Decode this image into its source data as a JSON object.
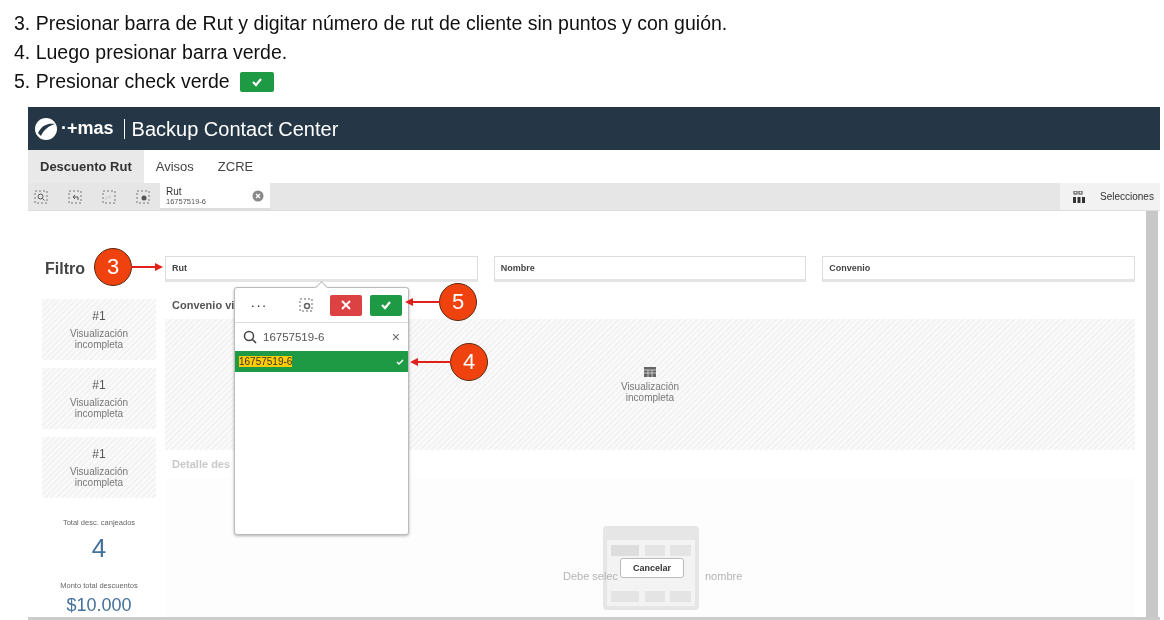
{
  "instructions": [
    {
      "text": "3. Presionar barra de Rut y digitar número de rut de cliente sin puntos y con guión."
    },
    {
      "text": "4. Luego presionar barra verde."
    },
    {
      "text": "5. Presionar check verde",
      "icon": true
    }
  ],
  "app": {
    "logo_text": "·+mas",
    "title": "Backup Contact Center",
    "tabs": [
      {
        "label": "Descuento Rut",
        "selected": true
      },
      {
        "label": "Avisos",
        "selected": false
      },
      {
        "label": "ZCRE",
        "selected": false
      }
    ],
    "selection_chip": {
      "field": "Rut",
      "value": "16757519-6"
    },
    "selections_label": "Selecciones",
    "filter_title": "Filtro",
    "filters": [
      {
        "label": "Rut"
      },
      {
        "label": "Nombre"
      },
      {
        "label": "Convenio"
      }
    ],
    "kpi_cards": [
      {
        "rank": "#1",
        "text": "Visualización incompleta"
      },
      {
        "rank": "#1",
        "text": "Visualización incompleta"
      },
      {
        "rank": "#1",
        "text": "Visualización incompleta"
      }
    ],
    "kpis": [
      {
        "label": "Total desc. canjeados",
        "value": "4"
      },
      {
        "label": "Monto total descuentos",
        "value": "$10.000"
      }
    ],
    "convenio_title": "Convenio vi",
    "convenio_placeholder": "Visualización incompleta",
    "detalle_title": "Detalle des",
    "empty_message_parts": [
      "Debe selec",
      "nombre"
    ],
    "cancel_button": "Cancelar",
    "listbox": {
      "menu": "···",
      "search": "16757519-6",
      "clear": "×",
      "items": [
        {
          "value": "16757519-6",
          "selected": true
        }
      ]
    }
  },
  "callouts": [
    {
      "number": "3"
    },
    {
      "number": "5"
    },
    {
      "number": "4"
    }
  ]
}
